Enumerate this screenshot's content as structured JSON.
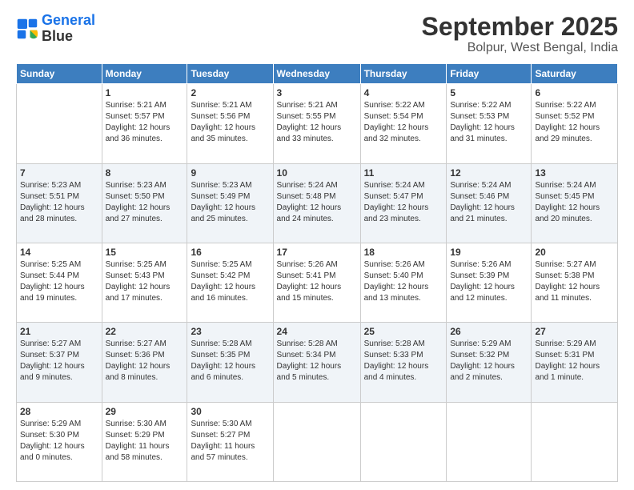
{
  "logo": {
    "line1": "General",
    "line2": "Blue"
  },
  "title": "September 2025",
  "subtitle": "Bolpur, West Bengal, India",
  "headers": [
    "Sunday",
    "Monday",
    "Tuesday",
    "Wednesday",
    "Thursday",
    "Friday",
    "Saturday"
  ],
  "weeks": [
    [
      {
        "day": "",
        "info": ""
      },
      {
        "day": "1",
        "info": "Sunrise: 5:21 AM\nSunset: 5:57 PM\nDaylight: 12 hours\nand 36 minutes."
      },
      {
        "day": "2",
        "info": "Sunrise: 5:21 AM\nSunset: 5:56 PM\nDaylight: 12 hours\nand 35 minutes."
      },
      {
        "day": "3",
        "info": "Sunrise: 5:21 AM\nSunset: 5:55 PM\nDaylight: 12 hours\nand 33 minutes."
      },
      {
        "day": "4",
        "info": "Sunrise: 5:22 AM\nSunset: 5:54 PM\nDaylight: 12 hours\nand 32 minutes."
      },
      {
        "day": "5",
        "info": "Sunrise: 5:22 AM\nSunset: 5:53 PM\nDaylight: 12 hours\nand 31 minutes."
      },
      {
        "day": "6",
        "info": "Sunrise: 5:22 AM\nSunset: 5:52 PM\nDaylight: 12 hours\nand 29 minutes."
      }
    ],
    [
      {
        "day": "7",
        "info": "Sunrise: 5:23 AM\nSunset: 5:51 PM\nDaylight: 12 hours\nand 28 minutes."
      },
      {
        "day": "8",
        "info": "Sunrise: 5:23 AM\nSunset: 5:50 PM\nDaylight: 12 hours\nand 27 minutes."
      },
      {
        "day": "9",
        "info": "Sunrise: 5:23 AM\nSunset: 5:49 PM\nDaylight: 12 hours\nand 25 minutes."
      },
      {
        "day": "10",
        "info": "Sunrise: 5:24 AM\nSunset: 5:48 PM\nDaylight: 12 hours\nand 24 minutes."
      },
      {
        "day": "11",
        "info": "Sunrise: 5:24 AM\nSunset: 5:47 PM\nDaylight: 12 hours\nand 23 minutes."
      },
      {
        "day": "12",
        "info": "Sunrise: 5:24 AM\nSunset: 5:46 PM\nDaylight: 12 hours\nand 21 minutes."
      },
      {
        "day": "13",
        "info": "Sunrise: 5:24 AM\nSunset: 5:45 PM\nDaylight: 12 hours\nand 20 minutes."
      }
    ],
    [
      {
        "day": "14",
        "info": "Sunrise: 5:25 AM\nSunset: 5:44 PM\nDaylight: 12 hours\nand 19 minutes."
      },
      {
        "day": "15",
        "info": "Sunrise: 5:25 AM\nSunset: 5:43 PM\nDaylight: 12 hours\nand 17 minutes."
      },
      {
        "day": "16",
        "info": "Sunrise: 5:25 AM\nSunset: 5:42 PM\nDaylight: 12 hours\nand 16 minutes."
      },
      {
        "day": "17",
        "info": "Sunrise: 5:26 AM\nSunset: 5:41 PM\nDaylight: 12 hours\nand 15 minutes."
      },
      {
        "day": "18",
        "info": "Sunrise: 5:26 AM\nSunset: 5:40 PM\nDaylight: 12 hours\nand 13 minutes."
      },
      {
        "day": "19",
        "info": "Sunrise: 5:26 AM\nSunset: 5:39 PM\nDaylight: 12 hours\nand 12 minutes."
      },
      {
        "day": "20",
        "info": "Sunrise: 5:27 AM\nSunset: 5:38 PM\nDaylight: 12 hours\nand 11 minutes."
      }
    ],
    [
      {
        "day": "21",
        "info": "Sunrise: 5:27 AM\nSunset: 5:37 PM\nDaylight: 12 hours\nand 9 minutes."
      },
      {
        "day": "22",
        "info": "Sunrise: 5:27 AM\nSunset: 5:36 PM\nDaylight: 12 hours\nand 8 minutes."
      },
      {
        "day": "23",
        "info": "Sunrise: 5:28 AM\nSunset: 5:35 PM\nDaylight: 12 hours\nand 6 minutes."
      },
      {
        "day": "24",
        "info": "Sunrise: 5:28 AM\nSunset: 5:34 PM\nDaylight: 12 hours\nand 5 minutes."
      },
      {
        "day": "25",
        "info": "Sunrise: 5:28 AM\nSunset: 5:33 PM\nDaylight: 12 hours\nand 4 minutes."
      },
      {
        "day": "26",
        "info": "Sunrise: 5:29 AM\nSunset: 5:32 PM\nDaylight: 12 hours\nand 2 minutes."
      },
      {
        "day": "27",
        "info": "Sunrise: 5:29 AM\nSunset: 5:31 PM\nDaylight: 12 hours\nand 1 minute."
      }
    ],
    [
      {
        "day": "28",
        "info": "Sunrise: 5:29 AM\nSunset: 5:30 PM\nDaylight: 12 hours\nand 0 minutes."
      },
      {
        "day": "29",
        "info": "Sunrise: 5:30 AM\nSunset: 5:29 PM\nDaylight: 11 hours\nand 58 minutes."
      },
      {
        "day": "30",
        "info": "Sunrise: 5:30 AM\nSunset: 5:27 PM\nDaylight: 11 hours\nand 57 minutes."
      },
      {
        "day": "",
        "info": ""
      },
      {
        "day": "",
        "info": ""
      },
      {
        "day": "",
        "info": ""
      },
      {
        "day": "",
        "info": ""
      }
    ]
  ]
}
